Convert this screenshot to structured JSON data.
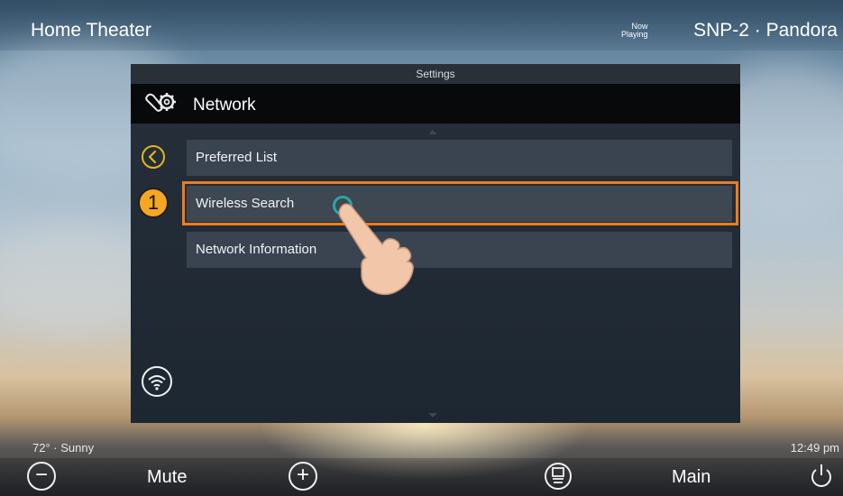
{
  "header": {
    "title": "Home Theater",
    "now_playing_line1": "Now",
    "now_playing_line2": "Playing",
    "source": "SNP-2 · Pandora"
  },
  "panel": {
    "title": "Settings",
    "section": "Network",
    "items": [
      {
        "label": "Preferred List"
      },
      {
        "label": "Wireless Search"
      },
      {
        "label": "Network Information"
      }
    ]
  },
  "annotation": {
    "step": "1",
    "highlight_color": "#f07b1b"
  },
  "status": {
    "weather": "72° · Sunny",
    "time": "12:49 pm"
  },
  "footer": {
    "mute_label": "Mute",
    "main_label": "Main",
    "minus_glyph": "−",
    "plus_glyph": "+"
  },
  "icons": {
    "back": "back-arrow-icon",
    "settings": "gear-wrench-icon",
    "wifi": "wifi-icon",
    "media": "media-source-icon",
    "power": "power-icon"
  },
  "colors": {
    "accent_gold": "#e5b41e",
    "tap_ring": "#2aa7a3",
    "row_bg": "#3a4450"
  }
}
